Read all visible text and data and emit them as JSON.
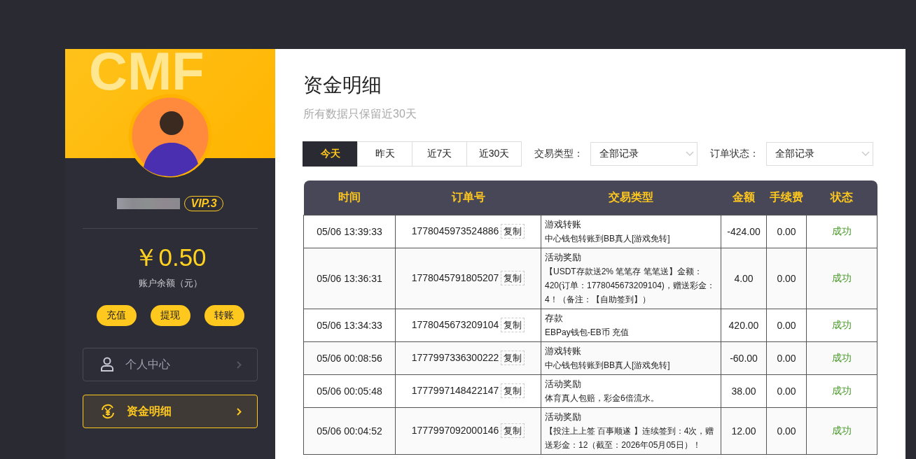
{
  "sidebar": {
    "banner_text": "CMF",
    "vip": "VIP.3",
    "balance": "￥0.50",
    "balance_label": "账户余额（元）",
    "actions": [
      "充值",
      "提现",
      "转账"
    ],
    "menu": [
      {
        "label": "个人中心",
        "kind": "person",
        "selected": false
      },
      {
        "label": "资金明细",
        "kind": "yen",
        "selected": true
      }
    ]
  },
  "page": {
    "title": "资金明细",
    "subtitle": "所有数据只保留近30天"
  },
  "filters": {
    "ranges": [
      {
        "label": "今天",
        "selected": true
      },
      {
        "label": "昨天",
        "selected": false
      },
      {
        "label": "近7天",
        "selected": false
      },
      {
        "label": "近30天",
        "selected": false
      }
    ],
    "type_label": "交易类型：",
    "type_value": "全部记录",
    "status_label": "订单状态：",
    "status_value": "全部记录"
  },
  "table": {
    "columns": [
      "时间",
      "订单号",
      "交易类型",
      "金额",
      "手续费",
      "状态"
    ],
    "rows": [
      {
        "time": "05/06 13:39:33",
        "order": "1778045973524886",
        "copy": "复制",
        "type": "游戏转账",
        "detail": "中心钱包转账到BB真人[游戏免转]",
        "amount": "-424.00",
        "fee": "0.00",
        "status": "成功"
      },
      {
        "time": "05/06 13:36:31",
        "order": "1778045791805207",
        "copy": "复制",
        "type": "活动奖励",
        "detail": "【USDT存款送2% 笔笔存 笔笔送】金额：420(订单：1778045673209104)，赠送彩金：4！（备注：【自助签到】）",
        "amount": "4.00",
        "fee": "0.00",
        "status": "成功"
      },
      {
        "time": "05/06 13:34:33",
        "order": "1778045673209104",
        "copy": "复制",
        "type": "存款",
        "detail": "EBPay钱包-EB币 充值",
        "amount": "420.00",
        "fee": "0.00",
        "status": "成功"
      },
      {
        "time": "05/06 00:08:56",
        "order": "1777997336300222",
        "copy": "复制",
        "type": "游戏转账",
        "detail": "中心钱包转账到BB真人[游戏免转]",
        "amount": "-60.00",
        "fee": "0.00",
        "status": "成功"
      },
      {
        "time": "05/06 00:05:48",
        "order": "1777997148422147",
        "copy": "复制",
        "type": "活动奖励",
        "detail": "体育真人包赔，彩金6倍流水。",
        "amount": "38.00",
        "fee": "0.00",
        "status": "成功"
      },
      {
        "time": "05/06 00:04:52",
        "order": "1777997092000146",
        "copy": "复制",
        "type": "活动奖励",
        "detail": "【投注上上签 百事顺遂 】连续签到：4次，赠送彩金：12（截至：2026年05月05日）！",
        "amount": "12.00",
        "fee": "0.00",
        "status": "成功"
      }
    ]
  }
}
